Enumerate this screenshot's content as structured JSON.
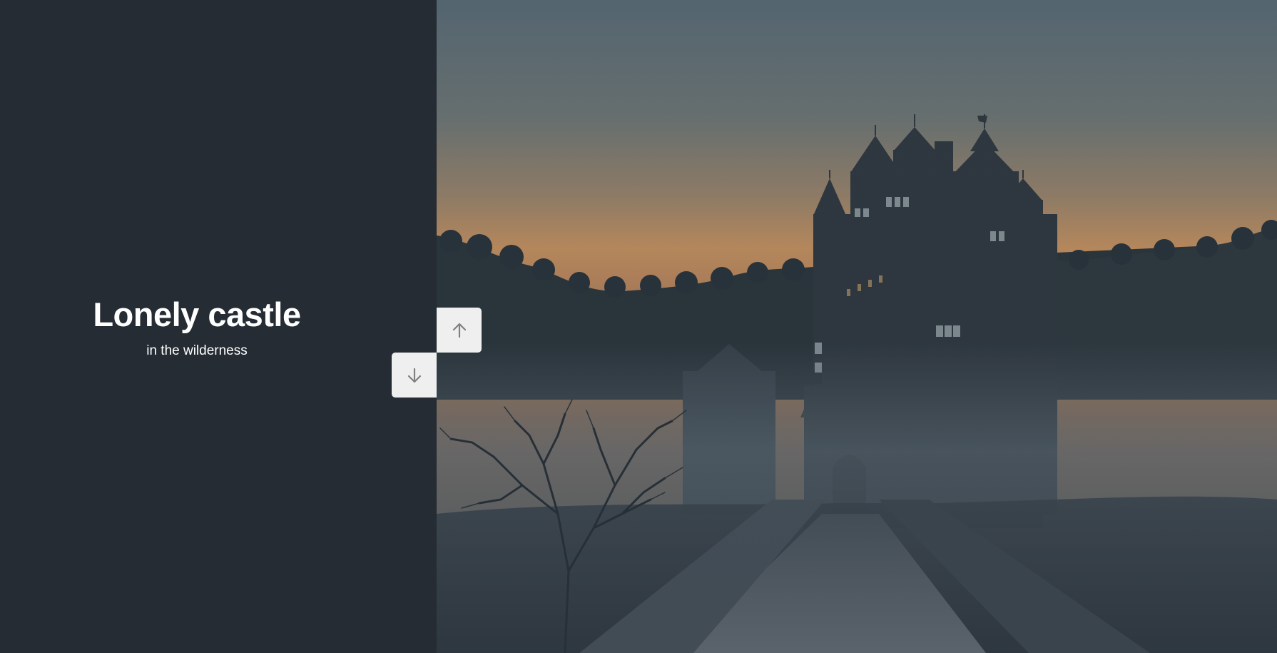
{
  "slide": {
    "title": "Lonely castle",
    "subtitle": "in the wilderness"
  },
  "image": {
    "subject": "castle in misty forest at dusk"
  },
  "controls": {
    "up_icon": "arrow-up-icon",
    "down_icon": "arrow-down-icon"
  },
  "colors": {
    "panel_bg": "#252c34",
    "text": "#ffffff",
    "button_bg": "#efefef",
    "icon": "#808080"
  }
}
